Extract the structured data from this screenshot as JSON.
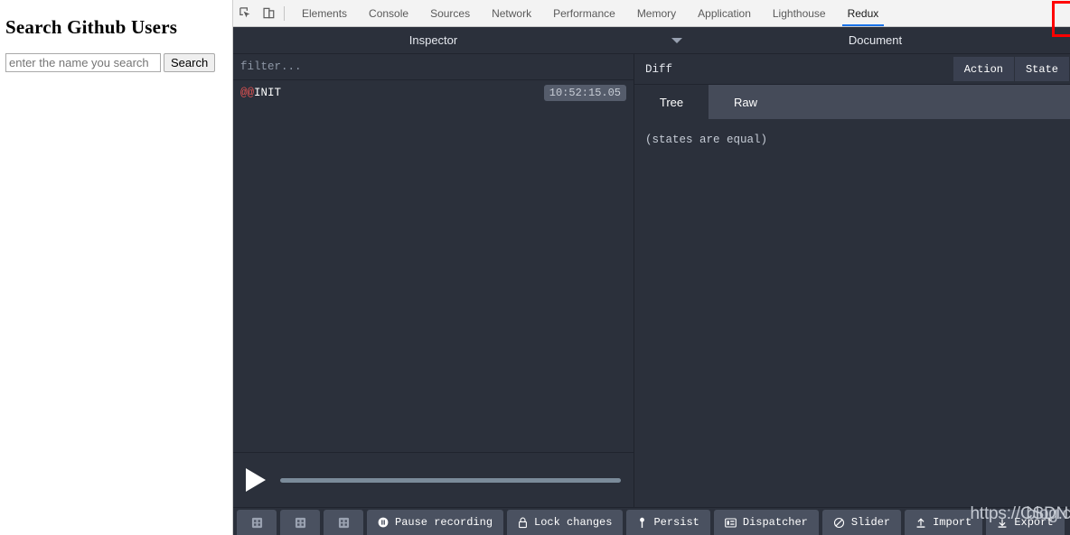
{
  "page": {
    "title": "Search Github Users",
    "search_placeholder": "enter the name you search",
    "search_value": "",
    "search_button": "Search"
  },
  "devtools": {
    "icons": {
      "inspect": "inspect-element-icon",
      "device": "device-toolbar-icon"
    },
    "tabs": [
      {
        "label": "Elements",
        "active": false
      },
      {
        "label": "Console",
        "active": false
      },
      {
        "label": "Sources",
        "active": false
      },
      {
        "label": "Network",
        "active": false
      },
      {
        "label": "Performance",
        "active": false
      },
      {
        "label": "Memory",
        "active": false
      },
      {
        "label": "Application",
        "active": false
      },
      {
        "label": "Lighthouse",
        "active": false
      },
      {
        "label": "Redux",
        "active": true
      }
    ],
    "annotation_color": "#ff0000",
    "active_tab_underline_color": "#1a73e8"
  },
  "monitor": {
    "header": {
      "inspector_title": "Inspector",
      "document_title": "Document"
    },
    "filter_placeholder": "filter...",
    "actions": [
      {
        "name_prefix": "@@",
        "name": "INIT",
        "time": "10:52:15.05"
      }
    ],
    "diff": {
      "label": "Diff",
      "segments": [
        {
          "label": "Action"
        },
        {
          "label": "State"
        }
      ],
      "subtabs": [
        {
          "label": "Tree",
          "active": true
        },
        {
          "label": "Raw",
          "active": false
        }
      ],
      "content": "(states are equal)"
    },
    "slider": {
      "play_icon": "play-icon",
      "value": 0
    }
  },
  "footer": {
    "buttons": [
      {
        "label": "",
        "icon": "layout-grid-icon",
        "icon_only": true
      },
      {
        "label": "",
        "icon": "layout-grid-icon",
        "icon_only": true
      },
      {
        "label": "",
        "icon": "layout-grid-icon",
        "icon_only": true
      },
      {
        "label": "Pause recording",
        "icon": "pause-record-icon",
        "icon_only": false
      },
      {
        "label": "Lock changes",
        "icon": "lock-icon",
        "icon_only": false
      },
      {
        "label": "Persist",
        "icon": "pin-icon",
        "icon_only": false
      },
      {
        "label": "Dispatcher",
        "icon": "dispatcher-icon",
        "icon_only": false
      },
      {
        "label": "Slider",
        "icon": "slider-off-icon",
        "icon_only": false
      },
      {
        "label": "Import",
        "icon": "import-icon",
        "icon_only": false
      },
      {
        "label": "Export",
        "icon": "export-icon",
        "icon_only": false
      }
    ]
  },
  "watermark": {
    "line1": "https://CSDN",
    "line2": "blog.csdn.net @ LittleMooncey yk"
  },
  "colors": {
    "panel_bg": "#2b303b",
    "toolbar_bg": "#f3f3f3",
    "button_bg": "#4a5160",
    "slider_track": "#7b8b9a",
    "accent": "#1a73e8",
    "annotation": "#ff0000"
  }
}
